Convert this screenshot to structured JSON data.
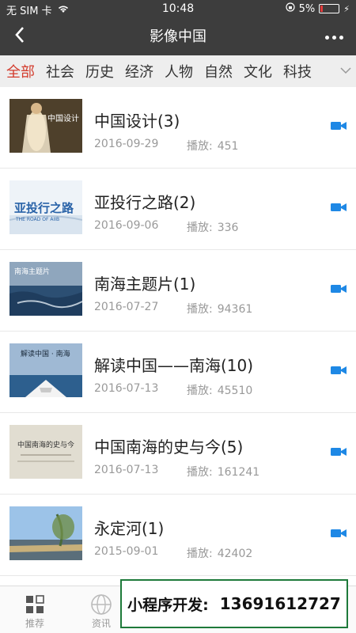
{
  "status": {
    "carrier": "无 SIM 卡",
    "time": "10:48",
    "battery": "5%"
  },
  "nav": {
    "title": "影像中国"
  },
  "tabs": [
    "全部",
    "社会",
    "历史",
    "经济",
    "人物",
    "自然",
    "文化",
    "科技"
  ],
  "play_label": "播放:",
  "items": [
    {
      "title": "中国设计(3)",
      "date": "2016-09-29",
      "plays": "451",
      "thumb_text": "中国设计"
    },
    {
      "title": "亚投行之路(2)",
      "date": "2016-09-06",
      "plays": "336",
      "thumb_text": "亚投行之路",
      "thumb_sub": "THE ROAD OF AIIB"
    },
    {
      "title": "南海主题片(1)",
      "date": "2016-07-27",
      "plays": "94361",
      "thumb_text": "南海主题片"
    },
    {
      "title": "解读中国——南海(10)",
      "date": "2016-07-13",
      "plays": "45510",
      "thumb_text": "解读中国 · 南海"
    },
    {
      "title": "中国南海的史与今(5)",
      "date": "2016-07-13",
      "plays": "161241",
      "thumb_text": "中国南海的史与今"
    },
    {
      "title": "永定河(1)",
      "date": "2015-09-01",
      "plays": "42402",
      "thumb_text": ""
    }
  ],
  "bottom_tabs": [
    "推荐",
    "资讯"
  ],
  "promo": {
    "label": "小程序开发:",
    "phone": "13691612727"
  },
  "colors": {
    "accent": "#d33b2c",
    "video_icon": "#1e88e5",
    "nav_bg": "#3d3d3d"
  }
}
